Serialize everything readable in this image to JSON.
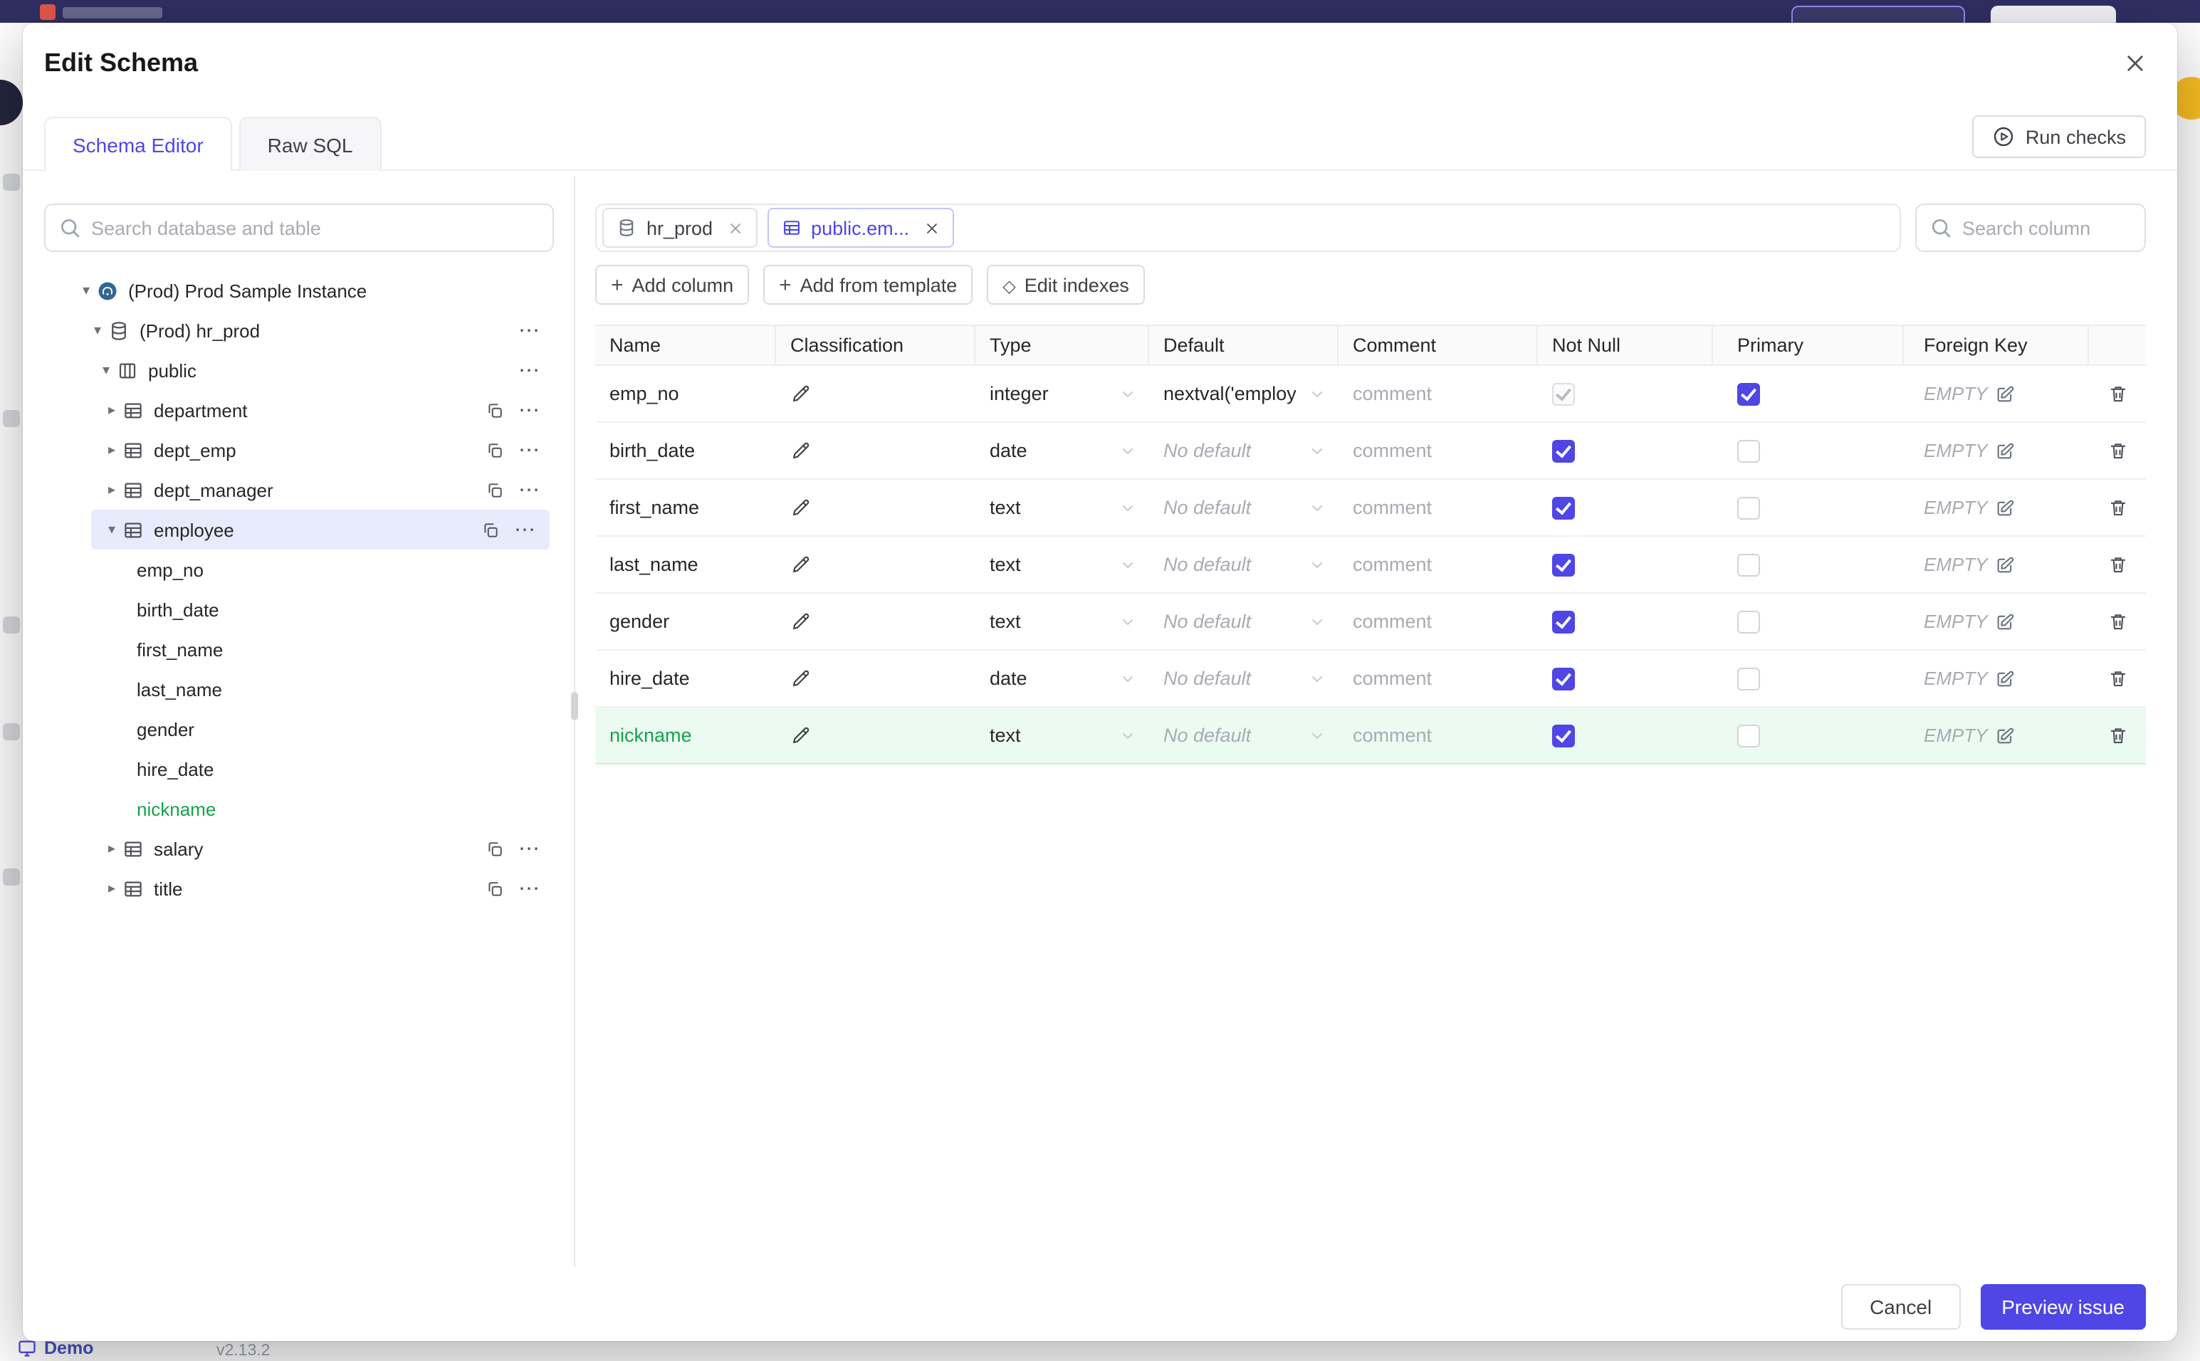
{
  "colors": {
    "accent": "#4f46e5",
    "new_item_green": "#16a34a",
    "new_row_bg": "#ecfbf2",
    "topbar": "#312e63"
  },
  "backdrop": {
    "demo_label": "Demo",
    "version": "v2.13.2"
  },
  "modal": {
    "title": "Edit Schema",
    "tabs": [
      {
        "label": "Schema Editor",
        "active": true
      },
      {
        "label": "Raw SQL",
        "active": false
      }
    ],
    "run_checks": "Run checks",
    "sidebar": {
      "search_placeholder": "Search database and table",
      "tree": [
        {
          "label": "(Prod) Prod Sample Instance",
          "type": "instance",
          "expanded": true
        },
        {
          "label": "(Prod) hr_prod",
          "type": "database",
          "expanded": true
        },
        {
          "label": "public",
          "type": "schema",
          "expanded": true
        },
        {
          "label": "department",
          "type": "table",
          "expanded": false
        },
        {
          "label": "dept_emp",
          "type": "table",
          "expanded": false
        },
        {
          "label": "dept_manager",
          "type": "table",
          "expanded": false
        },
        {
          "label": "employee",
          "type": "table",
          "expanded": true,
          "selected": true
        },
        {
          "label": "emp_no",
          "type": "column"
        },
        {
          "label": "birth_date",
          "type": "column"
        },
        {
          "label": "first_name",
          "type": "column"
        },
        {
          "label": "last_name",
          "type": "column"
        },
        {
          "label": "gender",
          "type": "column"
        },
        {
          "label": "hire_date",
          "type": "column"
        },
        {
          "label": "nickname",
          "type": "column",
          "new": true
        },
        {
          "label": "salary",
          "type": "table",
          "expanded": false
        },
        {
          "label": "title",
          "type": "table",
          "expanded": false
        }
      ]
    },
    "main": {
      "chips": [
        {
          "label": "hr_prod",
          "type": "database",
          "active": false
        },
        {
          "label": "public.em...",
          "type": "table",
          "active": true
        }
      ],
      "column_search_placeholder": "Search column",
      "toolbar": {
        "add_column": "Add column",
        "add_from_template": "Add from template",
        "edit_indexes": "Edit indexes"
      },
      "table": {
        "headers": [
          "Name",
          "Classification",
          "Type",
          "Default",
          "Comment",
          "Not Null",
          "Primary",
          "Foreign Key"
        ],
        "rows": [
          {
            "name": "emp_no",
            "type": "integer",
            "default": "nextval('employ",
            "comment": "comment",
            "not_null": true,
            "not_null_disabled": true,
            "primary": true,
            "foreign_key": "EMPTY",
            "new": false
          },
          {
            "name": "birth_date",
            "type": "date",
            "default": "No default",
            "comment": "comment",
            "not_null": true,
            "not_null_disabled": false,
            "primary": false,
            "foreign_key": "EMPTY",
            "new": false
          },
          {
            "name": "first_name",
            "type": "text",
            "default": "No default",
            "comment": "comment",
            "not_null": true,
            "not_null_disabled": false,
            "primary": false,
            "foreign_key": "EMPTY",
            "new": false
          },
          {
            "name": "last_name",
            "type": "text",
            "default": "No default",
            "comment": "comment",
            "not_null": true,
            "not_null_disabled": false,
            "primary": false,
            "foreign_key": "EMPTY",
            "new": false
          },
          {
            "name": "gender",
            "type": "text",
            "default": "No default",
            "comment": "comment",
            "not_null": true,
            "not_null_disabled": false,
            "primary": false,
            "foreign_key": "EMPTY",
            "new": false
          },
          {
            "name": "hire_date",
            "type": "date",
            "default": "No default",
            "comment": "comment",
            "not_null": true,
            "not_null_disabled": false,
            "primary": false,
            "foreign_key": "EMPTY",
            "new": false
          },
          {
            "name": "nickname",
            "type": "text",
            "default": "No default",
            "comment": "comment",
            "not_null": true,
            "not_null_disabled": false,
            "primary": false,
            "foreign_key": "EMPTY",
            "new": true
          }
        ]
      }
    },
    "footer": {
      "cancel": "Cancel",
      "preview": "Preview issue"
    }
  }
}
